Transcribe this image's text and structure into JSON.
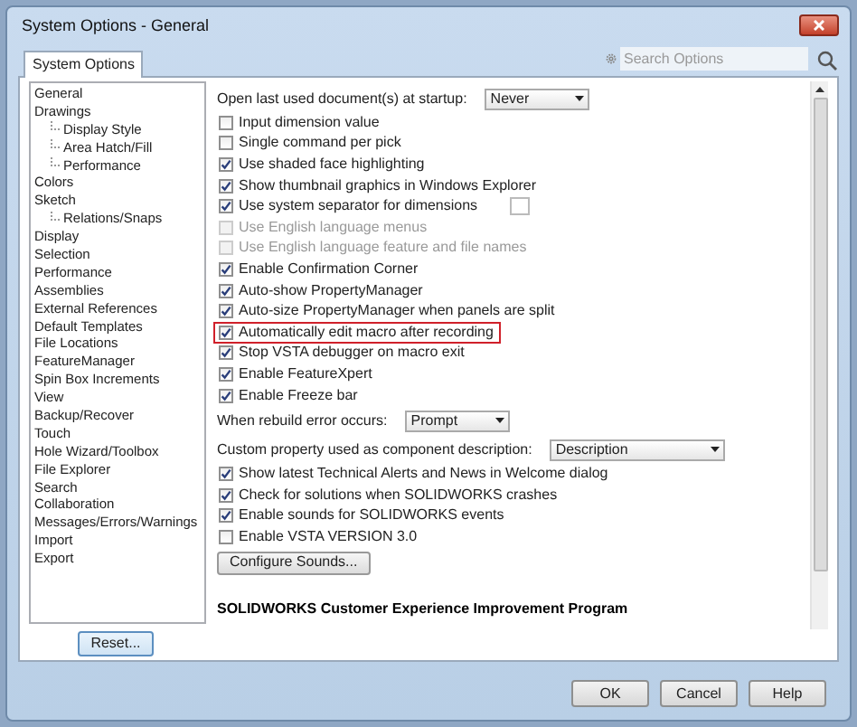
{
  "window": {
    "title": "System Options - General"
  },
  "tabs": [
    {
      "label": "System Options",
      "selected": true
    }
  ],
  "search": {
    "placeholder": "Search Options"
  },
  "tree": [
    {
      "label": "General"
    },
    {
      "label": "Drawings",
      "children": [
        {
          "label": "Display Style"
        },
        {
          "label": "Area Hatch/Fill"
        },
        {
          "label": "Performance"
        }
      ]
    },
    {
      "label": "Colors"
    },
    {
      "label": "Sketch",
      "children": [
        {
          "label": "Relations/Snaps"
        }
      ]
    },
    {
      "label": "Display"
    },
    {
      "label": "Selection"
    },
    {
      "label": "Performance"
    },
    {
      "label": "Assemblies"
    },
    {
      "label": "External References"
    },
    {
      "label": "Default Templates"
    },
    {
      "label": "File Locations"
    },
    {
      "label": "FeatureManager"
    },
    {
      "label": "Spin Box Increments"
    },
    {
      "label": "View"
    },
    {
      "label": "Backup/Recover"
    },
    {
      "label": "Touch"
    },
    {
      "label": "Hole Wizard/Toolbox"
    },
    {
      "label": "File Explorer"
    },
    {
      "label": "Search"
    },
    {
      "label": "Collaboration"
    },
    {
      "label": "Messages/Errors/Warnings"
    },
    {
      "label": "Import"
    },
    {
      "label": "Export"
    }
  ],
  "reset_button": "Reset...",
  "options": [
    {
      "kind": "dropdown",
      "label": "Open last used document(s) at startup:",
      "value": "Never"
    },
    {
      "kind": "checkbox",
      "label": "Input dimension value",
      "checked": false,
      "disabled": false,
      "highlighted": false
    },
    {
      "kind": "checkbox",
      "label": "Single command per pick",
      "checked": false,
      "disabled": false,
      "highlighted": false
    },
    {
      "kind": "checkbox",
      "label": "Use shaded face highlighting",
      "checked": true,
      "disabled": false,
      "highlighted": false
    },
    {
      "kind": "checkbox",
      "label": "Show thumbnail graphics in Windows Explorer",
      "checked": true,
      "disabled": false,
      "highlighted": false
    },
    {
      "kind": "checkbox",
      "label": "Use system separator for dimensions",
      "checked": true,
      "disabled": false,
      "highlighted": false,
      "has_field": true
    },
    {
      "kind": "checkbox",
      "label": "Use English language menus",
      "checked": false,
      "disabled": true,
      "highlighted": false
    },
    {
      "kind": "checkbox",
      "label": "Use English language feature and file names",
      "checked": false,
      "disabled": true,
      "highlighted": false
    },
    {
      "kind": "checkbox",
      "label": "Enable Confirmation Corner",
      "checked": true,
      "disabled": false,
      "highlighted": false
    },
    {
      "kind": "checkbox",
      "label": "Auto-show PropertyManager",
      "checked": true,
      "disabled": false,
      "highlighted": false
    },
    {
      "kind": "checkbox",
      "label": "Auto-size PropertyManager when panels are split",
      "checked": true,
      "disabled": false,
      "highlighted": false
    },
    {
      "kind": "checkbox",
      "label": "Automatically edit macro after recording",
      "checked": true,
      "disabled": false,
      "highlighted": true
    },
    {
      "kind": "checkbox",
      "label": "Stop VSTA debugger on macro exit",
      "checked": true,
      "disabled": false,
      "highlighted": false
    },
    {
      "kind": "checkbox",
      "label": "Enable FeatureXpert",
      "checked": true,
      "disabled": false,
      "highlighted": false
    },
    {
      "kind": "checkbox",
      "label": "Enable Freeze bar",
      "checked": true,
      "disabled": false,
      "highlighted": false
    },
    {
      "kind": "dropdown",
      "label": "When rebuild error occurs:",
      "value": "Prompt"
    },
    {
      "kind": "dropdown",
      "label": "Custom property used as component description:",
      "value": "Description"
    },
    {
      "kind": "checkbox",
      "label": "Show latest Technical Alerts and News in Welcome dialog",
      "checked": true,
      "disabled": false,
      "highlighted": false
    },
    {
      "kind": "checkbox",
      "label": "Check for solutions when SOLIDWORKS crashes",
      "checked": true,
      "disabled": false,
      "highlighted": false
    },
    {
      "kind": "checkbox",
      "label": "Enable sounds for SOLIDWORKS events",
      "checked": true,
      "disabled": false,
      "highlighted": false
    },
    {
      "kind": "checkbox",
      "label": "Enable VSTA VERSION 3.0",
      "checked": false,
      "disabled": false,
      "highlighted": false
    },
    {
      "kind": "button",
      "label": "Configure Sounds..."
    },
    {
      "kind": "heading",
      "label": "SOLIDWORKS Customer Experience Improvement Program"
    }
  ],
  "buttons": [
    "OK",
    "Cancel",
    "Help"
  ]
}
